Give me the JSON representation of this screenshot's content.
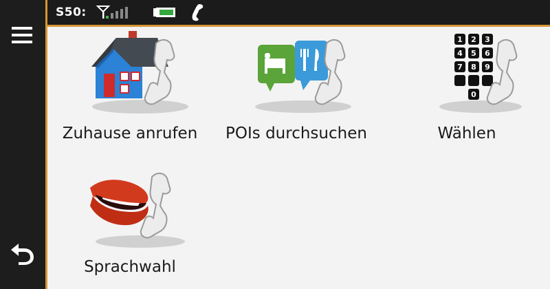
{
  "statusbar": {
    "device_name": "S50:",
    "icons": [
      "signal-icon",
      "battery-icon",
      "phone-connected-icon"
    ]
  },
  "sidebar": {
    "menu_icon": "hamburger-menu-icon",
    "back_icon": "back-arrow-icon"
  },
  "tiles": [
    {
      "label": "Zuhause anrufen",
      "icon": "home-phone-icon"
    },
    {
      "label": "POIs durchsuchen",
      "icon": "poi-phone-icon"
    },
    {
      "label": "Wählen",
      "icon": "dialpad-phone-icon"
    },
    {
      "label": "Sprachwahl",
      "icon": "voice-dial-icon"
    }
  ],
  "colors": {
    "accent": "#d79735",
    "rail": "#1d1d1d",
    "content_bg": "#f3f3f3"
  }
}
